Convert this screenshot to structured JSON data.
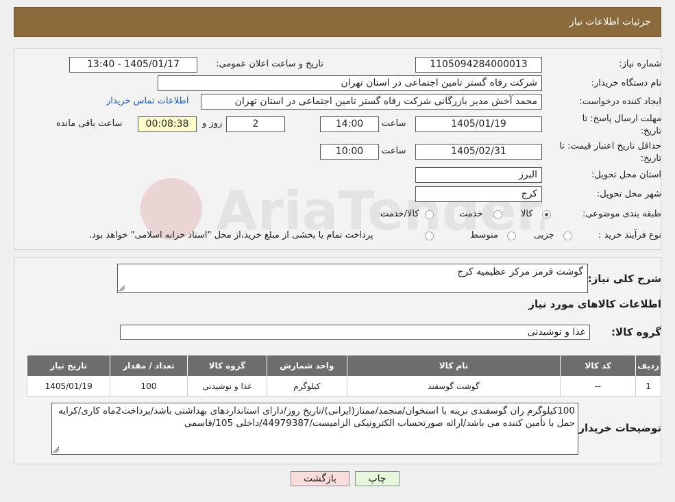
{
  "header": {
    "title": "جزئیات اطلاعات نیاز"
  },
  "form": {
    "need_number_label": "شماره نیاز:",
    "need_number": "1105094284000013",
    "announce_label": "تاریخ و ساعت اعلان عمومی:",
    "announce_value": "1405/01/17 - 13:40",
    "buyer_org_label": "نام دستگاه خریدار:",
    "buyer_org": "شرکت رفاه گستر تامین اجتماعی در استان تهران",
    "creator_label": "ایجاد کننده درخواست:",
    "creator": "محمد آخش مدیر بازرگانی شرکت رفاه گستر تامین اجتماعی در استان تهران",
    "contact_link": "اطلاعات تماس خریدار",
    "deadline_label_1": "مهلت ارسال پاسخ: تا",
    "deadline_label_2": "تاریخ:",
    "deadline_date": "1405/01/19",
    "time_label": "ساعت",
    "deadline_time": "14:00",
    "days_value": "2",
    "days_label": "روز و",
    "remaining_time": "00:08:38",
    "remaining_label": "ساعت باقی مانده",
    "validity_label_1": "حداقل تاریخ اعتبار قیمت: تا",
    "validity_label_2": "تاریخ:",
    "validity_date": "1405/02/31",
    "validity_time": "10:00",
    "province_label": "استان محل تحویل:",
    "province": "البرز",
    "city_label": "شهر محل تحویل:",
    "city": "کرج",
    "category_label": "طبقه بندی موضوعی:",
    "category_options": [
      "کالا",
      "خدمت",
      "کالا/خدمت"
    ],
    "category_selected": "کالا",
    "process_label": "نوع فرآیند خرید :",
    "process_options": [
      "جزیی",
      "متوسط"
    ],
    "process_note": "پرداخت تمام یا بخشی از مبلغ خرید،از محل \"اسناد خزانه اسلامی\" خواهد بود."
  },
  "details": {
    "summary_label": "شرح کلی نیاز:",
    "summary": "گوشت قرمز مرکز عظیمیه کرج",
    "goods_info_title": "اطلاعات کالاهای مورد نیاز",
    "goods_group_label": "گروه کالا:",
    "goods_group": "غذا و نوشیدنی",
    "table": {
      "headers": [
        "ردیف",
        "کد کالا",
        "نام کالا",
        "واحد شمارش",
        "گروه کالا",
        "تعداد / مقدار",
        "تاریخ نیاز"
      ],
      "rows": [
        [
          "1",
          "--",
          "گوشت گوسفند",
          "کیلوگرم",
          "غذا و نوشیدنی",
          "100",
          "1405/01/19"
        ]
      ]
    },
    "buyer_notes_label": "توضیحات خریدار:",
    "buyer_notes": "100کیلوگرم ران گوسفندی نرینه با استخوان/منجمد/ممتاز(ایرانی)/تاریخ روز/دارای استانداردهای بهداشتی باشد/پرداخت2ماه کاری/کرایه حمل با تأمین کننده می باشد/ارائه صورتحساب الکترونیکی الزامیست/44979387/داخلی 105/قاسمی"
  },
  "buttons": {
    "print": "چاپ",
    "back": "بازگشت"
  },
  "watermark": {
    "text": "AriaTender.neT"
  },
  "colors": {
    "header_bg": "#8b6a3c",
    "table_header_bg": "#6d6d6d",
    "link": "#1a5fb4",
    "timer_bg": "#ffffcc",
    "back_btn_bg": "#f9dcdc",
    "print_btn_bg": "#e6f7dc"
  }
}
